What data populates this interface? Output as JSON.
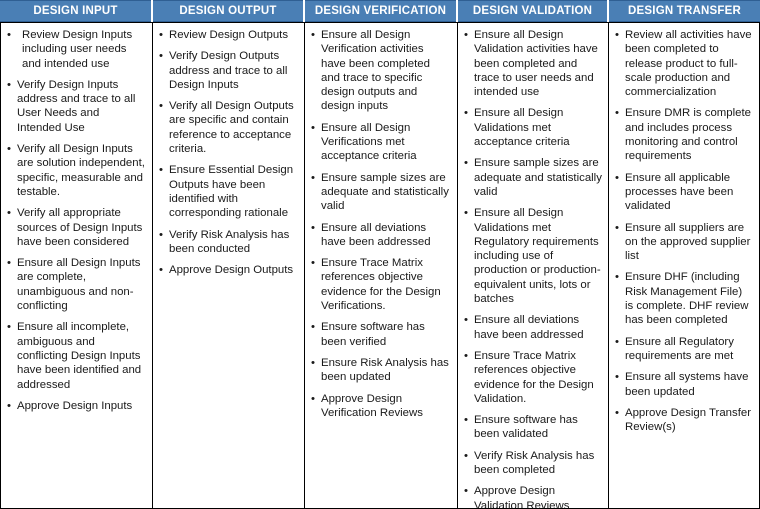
{
  "table": {
    "columns": [
      {
        "header": "DESIGN INPUT",
        "items": [
          "Review Design Inputs including user needs and intended use",
          "Verify Design Inputs address and trace to all User Needs and Intended Use",
          "Verify all Design Inputs are solution independent, specific, measurable and testable.",
          "Verify all appropriate sources of Design Inputs have been considered",
          "Ensure all Design Inputs are complete, unambiguous and non-conflicting",
          "Ensure all incomplete, ambiguous and conflicting Design Inputs have been identified and addressed",
          "Approve Design Inputs"
        ]
      },
      {
        "header": "DESIGN OUTPUT",
        "items": [
          "Review Design Outputs",
          "Verify Design Outputs address and trace to all Design Inputs",
          "Verify all Design Outputs are specific and contain reference to acceptance criteria.",
          "Ensure Essential Design Outputs have been identified with corresponding rationale",
          "Verify Risk Analysis has been conducted",
          "Approve Design Outputs"
        ]
      },
      {
        "header": "DESIGN VERIFICATION",
        "items": [
          "Ensure all Design Verification activities have been completed and trace to specific design outputs and design inputs",
          "Ensure all Design Verifications met acceptance criteria",
          "Ensure sample sizes are adequate and statistically valid",
          "Ensure all deviations have been addressed",
          "Ensure Trace Matrix references objective evidence for the Design Verifications.",
          "Ensure software has been verified",
          "Ensure Risk Analysis has been updated",
          "Approve Design Verification Reviews"
        ]
      },
      {
        "header": "DESIGN VALIDATION",
        "items": [
          "Ensure all Design Validation activities have been completed and trace to user needs and intended use",
          "Ensure all Design Validations met acceptance criteria",
          "Ensure sample sizes are adequate and statistically valid",
          "Ensure all Design Validations met Regulatory requirements including use of production or production-equivalent units, lots or batches",
          "Ensure all deviations have been addressed",
          "Ensure Trace Matrix references objective evidence for the Design Validation.",
          "Ensure software has been validated",
          "Verify Risk Analysis has been completed",
          "Approve Design Validation Reviews"
        ]
      },
      {
        "header": "DESIGN TRANSFER",
        "items": [
          "Review all activities have been completed to release product to full-scale production and commercialization",
          "Ensure DMR is complete and includes process monitoring and control requirements",
          "Ensure all applicable processes have been validated",
          "Ensure all suppliers are on the approved supplier list",
          "Ensure DHF (including Risk Management File) is complete. DHF review has been completed",
          "Ensure all Regulatory requirements are met",
          "Ensure all systems have been updated",
          "Approve Design Transfer Review(s)"
        ]
      }
    ],
    "bullet_glyph": "•",
    "colors": {
      "header_background": "#4a7fb5",
      "header_text": "#ffffff",
      "header_border": "#2f5f93",
      "body_text": "#1a1a1a",
      "grid_line": "#000000",
      "background": "#ffffff"
    }
  }
}
